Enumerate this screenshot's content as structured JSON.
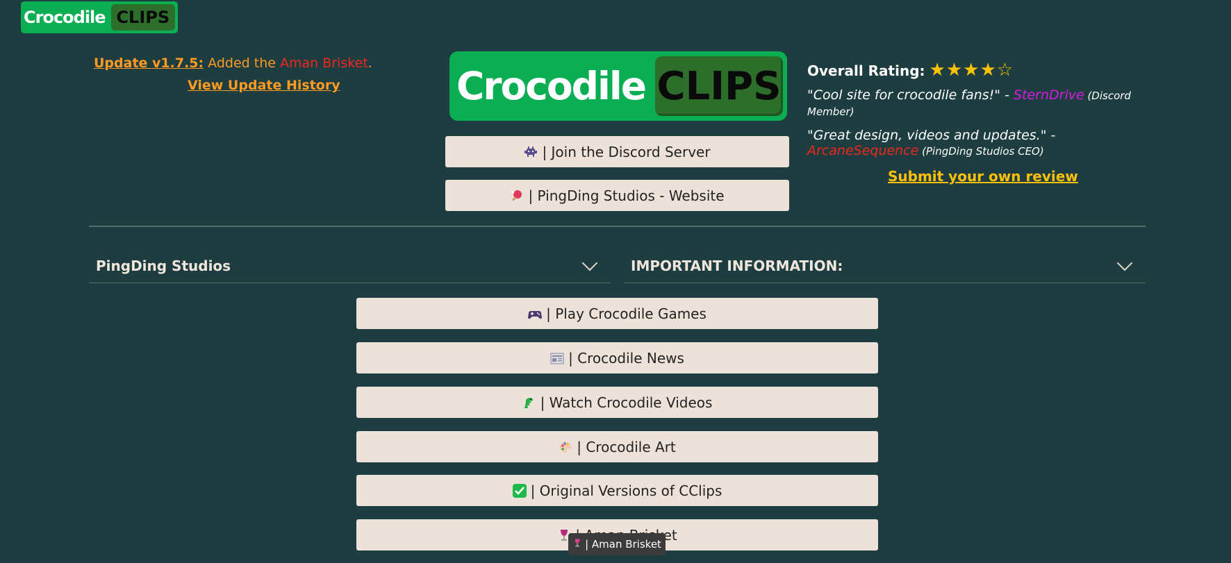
{
  "logo": {
    "word": "Crocodile",
    "clips": "CLIPS"
  },
  "update": {
    "version_label": "Update v1.7.5:",
    "text": " Added the ",
    "item": "Aman Brisket",
    "period": ".",
    "history_link": "View Update History"
  },
  "top_buttons": [
    {
      "icon": "alien-icon",
      "label": "| Join the Discord Server"
    },
    {
      "icon": "ping-pong-icon",
      "label": "| PingDing Studios - Website"
    }
  ],
  "reviews": {
    "rating_label": "Overall Rating:",
    "stars": "★★★★☆",
    "items": [
      {
        "quote": "\"Cool site for crocodile fans!\" - ",
        "name": "SternDrive",
        "role": " (Discord Member)"
      },
      {
        "quote": "\"Great design, videos and updates.\" - ",
        "name": "ArcaneSequence",
        "role": " (PingDing Studios CEO)"
      }
    ],
    "submit_link": "Submit your own review"
  },
  "sections": [
    {
      "title": "PingDing Studios"
    },
    {
      "title": "IMPORTANT INFORMATION:"
    }
  ],
  "menu_buttons": [
    {
      "icon": "game-controller-icon",
      "label": "| Play Crocodile Games"
    },
    {
      "icon": "newspaper-icon",
      "label": "| Crocodile News"
    },
    {
      "icon": "crocodile-icon",
      "label": "| Watch Crocodile Videos"
    },
    {
      "icon": "palette-icon",
      "label": "| Crocodile Art"
    },
    {
      "icon": "check-mark-icon",
      "label": "| Original Versions of CClips"
    },
    {
      "icon": "wine-glass-icon",
      "label": "| Aman Brisket"
    }
  ],
  "tooltip": {
    "label": "| Aman Brisket"
  },
  "colors": {
    "background": "#1e3d40",
    "accent_orange": "#ff9b21",
    "accent_red": "#f0271c",
    "logo_green": "#0bae52",
    "star": "#ffc107"
  }
}
